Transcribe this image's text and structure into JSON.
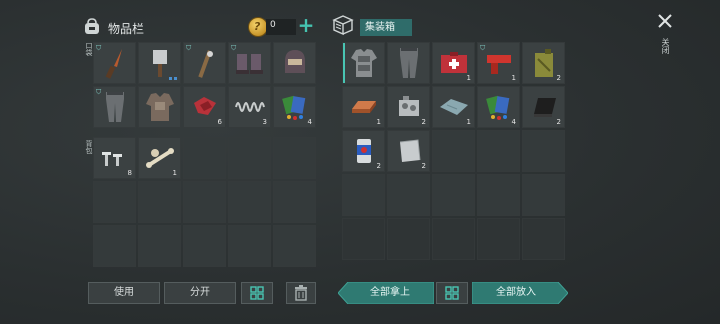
{
  "inventory": {
    "title": "物品栏",
    "coins": "0",
    "pocket_label": "口袋",
    "backpack_label": "背包",
    "pocket_slots": [
      {
        "icon": "knife-icon",
        "qty": "",
        "lock": true
      },
      {
        "icon": "cleaver-icon",
        "qty": "",
        "bars": true
      },
      {
        "icon": "spiked-club-icon",
        "qty": "",
        "lock": true
      },
      {
        "icon": "armored-boots-icon",
        "qty": "",
        "lock": true
      },
      {
        "icon": "hood-helmet-icon",
        "qty": ""
      },
      {
        "icon": "armored-pants-icon",
        "qty": "",
        "lock": true
      },
      {
        "icon": "leather-jacket-icon",
        "qty": ""
      },
      {
        "icon": "red-cloth-icon",
        "qty": "6"
      },
      {
        "icon": "spring-icon",
        "qty": "3"
      },
      {
        "icon": "seed-packs-icon",
        "qty": "4"
      }
    ],
    "backpack_slots": [
      {
        "icon": "nails-icon",
        "qty": "8"
      },
      {
        "icon": "bones-icon",
        "qty": "1"
      }
    ]
  },
  "storage": {
    "title": "集装箱",
    "slots": [
      {
        "icon": "armored-vest-icon",
        "qty": "",
        "selected": true
      },
      {
        "icon": "armored-pants-icon",
        "qty": ""
      },
      {
        "icon": "first-aid-kit-icon",
        "qty": "1"
      },
      {
        "icon": "flare-gun-icon",
        "qty": "1",
        "lock": true
      },
      {
        "icon": "jerry-can-icon",
        "qty": "2"
      },
      {
        "icon": "copper-ingot-icon",
        "qty": "1"
      },
      {
        "icon": "engine-parts-icon",
        "qty": "2"
      },
      {
        "icon": "fabric-sheet-icon",
        "qty": "1"
      },
      {
        "icon": "seed-packs-icon",
        "qty": "4"
      },
      {
        "icon": "rubber-sheet-icon",
        "qty": "2"
      },
      {
        "icon": "soda-can-icon",
        "qty": "2"
      },
      {
        "icon": "metal-plate-icon",
        "qty": "2"
      }
    ]
  },
  "buttons": {
    "use": "使用",
    "split": "分开",
    "take_all": "全部拿上",
    "put_all": "全部放入",
    "close": "关闭"
  },
  "colors": {
    "accent": "#49c5b3",
    "teal_button": "#2f7a72",
    "cell": "#3b4142"
  }
}
